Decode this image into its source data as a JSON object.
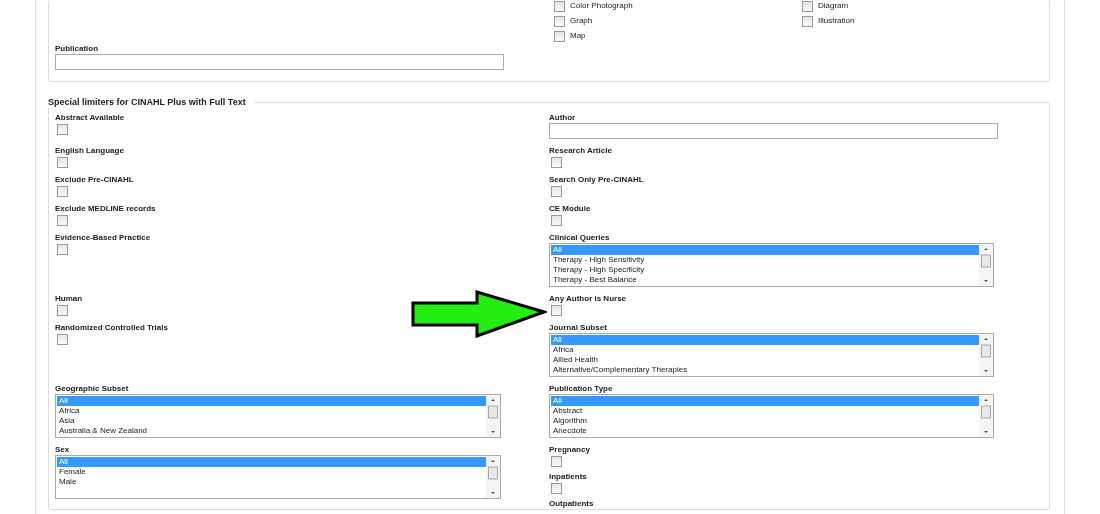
{
  "top_section": {
    "checkbox_columns": [
      [
        {
          "label": "Color Photograph",
          "checked": false
        },
        {
          "label": "Graph",
          "checked": false
        },
        {
          "label": "Map",
          "checked": false
        }
      ],
      [
        {
          "label": "Diagram",
          "checked": false
        },
        {
          "label": "Illustration",
          "checked": false
        }
      ]
    ],
    "publication_label": "Publication"
  },
  "special_limiters": {
    "title": "Special limiters for CINAHL Plus with Full Text",
    "rows": [
      {
        "left": [
          {
            "kind": "checkbox",
            "label": "Abstract Available",
            "checked": false
          }
        ],
        "right": [
          {
            "kind": "text",
            "label": "Author"
          }
        ]
      },
      {
        "left": [
          {
            "kind": "checkbox",
            "label": "English Language",
            "checked": false
          }
        ],
        "right": [
          {
            "kind": "checkbox",
            "label": "Research Article",
            "checked": false
          }
        ]
      },
      {
        "left": [
          {
            "kind": "checkbox",
            "label": "Exclude Pre-CINAHL",
            "checked": false
          }
        ],
        "right": [
          {
            "kind": "checkbox",
            "label": "Search Only Pre-CINAHL",
            "checked": false
          }
        ]
      },
      {
        "left": [
          {
            "kind": "checkbox",
            "label": "Exclude MEDLINE records",
            "checked": false
          }
        ],
        "right": [
          {
            "kind": "checkbox",
            "label": "CE Module",
            "checked": false
          }
        ]
      },
      {
        "left": [
          {
            "kind": "checkbox",
            "label": "Evidence-Based Practice",
            "checked": false
          }
        ],
        "right": [
          {
            "kind": "listbox",
            "label": "Clinical Queries",
            "options": [
              {
                "text": "All",
                "selected": true
              },
              {
                "text": "Therapy - High Sensitivity",
                "selected": false
              },
              {
                "text": "Therapy - High Specificity",
                "selected": false
              },
              {
                "text": "Therapy - Best Balance",
                "selected": false
              }
            ]
          }
        ]
      },
      {
        "left": [
          {
            "kind": "checkbox",
            "label": "Human",
            "checked": false
          }
        ],
        "right": [
          {
            "kind": "checkbox",
            "label": "Any Author is Nurse",
            "checked": false
          }
        ]
      },
      {
        "left": [
          {
            "kind": "checkbox",
            "label": "Randomized Controlled Trials",
            "checked": false
          }
        ],
        "right": [
          {
            "kind": "listbox",
            "label": "Journal Subset",
            "options": [
              {
                "text": "All",
                "selected": true
              },
              {
                "text": "Africa",
                "selected": false
              },
              {
                "text": "Allied Health",
                "selected": false
              },
              {
                "text": "Alternative/Complementary Therapies",
                "selected": false
              }
            ]
          }
        ]
      },
      {
        "left": [
          {
            "kind": "listbox",
            "label": "Geographic Subset",
            "options": [
              {
                "text": "All",
                "selected": true
              },
              {
                "text": "Africa",
                "selected": false
              },
              {
                "text": "Asia",
                "selected": false
              },
              {
                "text": "Australia & New Zealand",
                "selected": false
              }
            ]
          }
        ],
        "right": [
          {
            "kind": "listbox",
            "label": "Publication Type",
            "options": [
              {
                "text": "All",
                "selected": true
              },
              {
                "text": "Abstract",
                "selected": false
              },
              {
                "text": "Algorithm",
                "selected": false
              },
              {
                "text": "Anecdote",
                "selected": false
              }
            ]
          }
        ]
      },
      {
        "left": [
          {
            "kind": "listbox",
            "label": "Sex",
            "options": [
              {
                "text": "All",
                "selected": true
              },
              {
                "text": "Female",
                "selected": false
              },
              {
                "text": "Male",
                "selected": false
              }
            ]
          }
        ],
        "right": [
          {
            "kind": "checkbox",
            "label": "Pregnancy",
            "checked": false
          },
          {
            "kind": "checkbox",
            "label": "Inpatients",
            "checked": false
          },
          {
            "kind": "heading",
            "label": "Outpatients"
          }
        ]
      }
    ]
  }
}
